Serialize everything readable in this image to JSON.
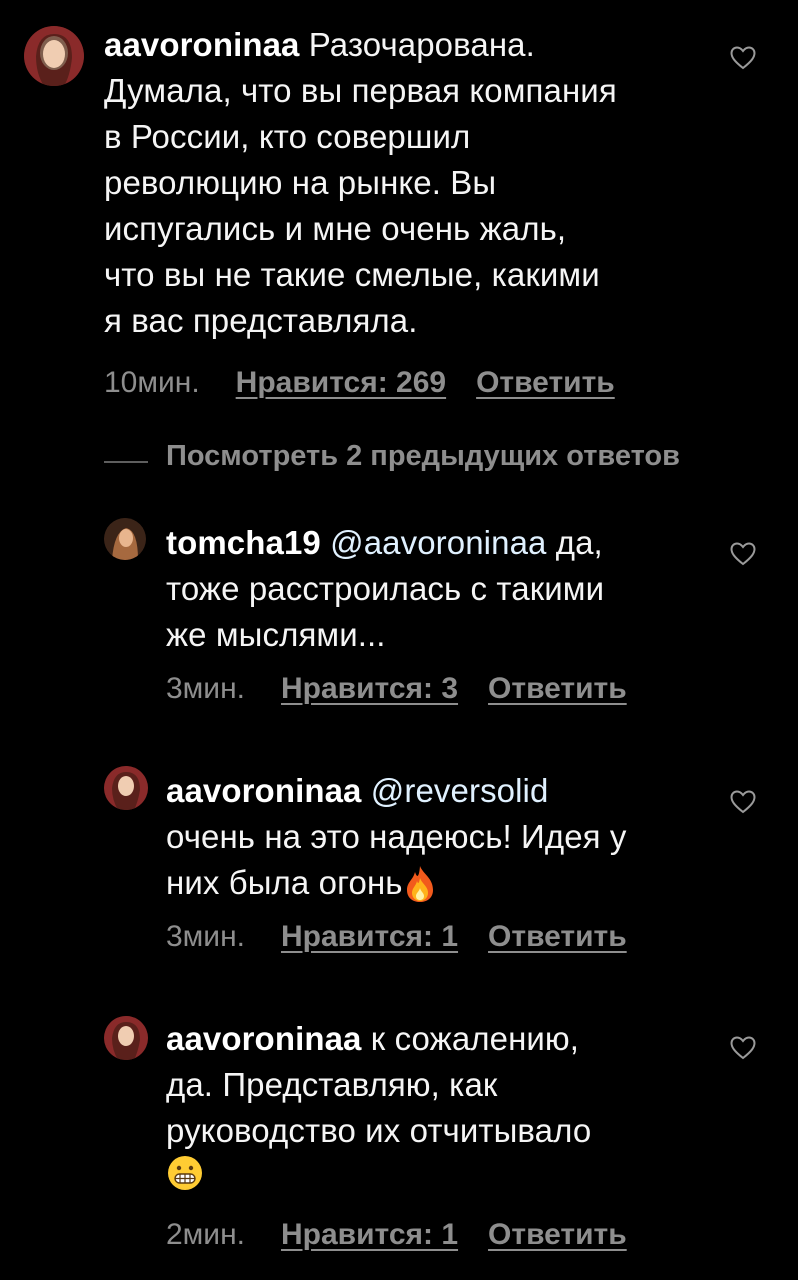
{
  "comments": [
    {
      "username": "aavoroninaa",
      "lines": [
        " Разочарована.",
        "Думала, что вы первая компания",
        "в России, кто совершил",
        "революцию на рынке. Вы",
        "испугались и мне очень жаль,",
        "что вы не такие смелые, какими",
        "я вас представляла."
      ],
      "time": "10мин.",
      "likes": "Нравится: 269",
      "reply": "Ответить"
    },
    {
      "username": "tomcha19",
      "mention": " @aavoroninaa",
      "lines": [
        " да,",
        "тоже расстроилась с такими",
        "же мыслями..."
      ],
      "time": "3мин.",
      "likes": "Нравится: 3",
      "reply": "Ответить"
    },
    {
      "username": "aavoroninaa",
      "mention": " @reversolid",
      "lines": [
        "очень на это надеюсь! Идея у",
        "них была огонь"
      ],
      "emoji": "fire",
      "time": "3мин.",
      "likes": "Нравится: 1",
      "reply": "Ответить"
    },
    {
      "username": "aavoroninaa",
      "lines": [
        " к сожалению,",
        "да. Представляю, как",
        "руководство их отчитывало"
      ],
      "emoji": "grimacing-face",
      "time": "2мин.",
      "likes": "Нравится: 1",
      "reply": "Ответить"
    }
  ],
  "view_previous": "Посмотреть 2 предыдущих ответов",
  "icons": {
    "like": "heart-outline-icon",
    "fire": "fire-emoji",
    "grimace": "grimacing-face-emoji"
  },
  "colors": {
    "background": "#000000",
    "text": "#f5f5f5",
    "meta": "#8e8e8e",
    "mention": "#e0f1ff"
  }
}
